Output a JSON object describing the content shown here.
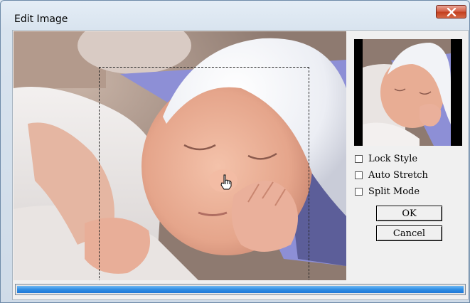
{
  "window": {
    "title": "Edit Image",
    "close_icon": "close-icon"
  },
  "image": {
    "description_icon": "photo-image"
  },
  "options": {
    "lock_style": {
      "label": "Lock Style",
      "checked": false
    },
    "auto_stretch": {
      "label": "Auto Stretch",
      "checked": false
    },
    "split_mode": {
      "label": "Split Mode",
      "checked": false
    }
  },
  "buttons": {
    "ok_label": "OK",
    "cancel_label": "Cancel"
  },
  "progress": {
    "fraction": 1.0
  },
  "colors": {
    "progress": "#2f8de4",
    "close": "#c3401f"
  }
}
